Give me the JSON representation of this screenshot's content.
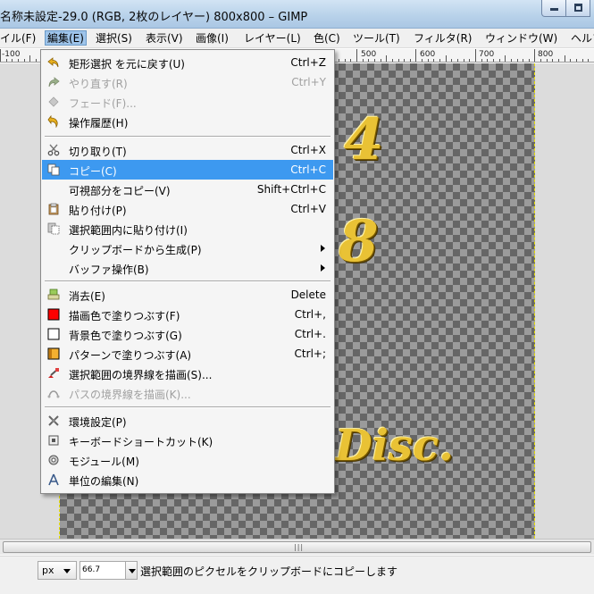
{
  "window": {
    "title": "名称未設定-29.0 (RGB, 2枚のレイヤー) 800x800 – GIMP"
  },
  "menubar": {
    "items": [
      "イル(F)",
      "編集(E)",
      "選択(S)",
      "表示(V)",
      "画像(I)",
      "レイヤー(L)",
      "色(C)",
      "ツール(T)",
      "フィルタ(R)",
      "ウィンドウ(W)",
      "ヘルプ"
    ],
    "active": "編集(E)"
  },
  "ruler": {
    "labels": [
      "-100",
      "500",
      "600",
      "700",
      "800"
    ]
  },
  "edit_menu": {
    "items": [
      {
        "label": "矩形選択 を元に戻す(U)",
        "shortcut": "Ctrl+Z",
        "icon": "undo-icon",
        "enabled": true
      },
      {
        "label": "やり直す(R)",
        "shortcut": "Ctrl+Y",
        "icon": "redo-icon",
        "enabled": false
      },
      {
        "label": "フェード(F)...",
        "shortcut": "",
        "icon": "fade-icon",
        "enabled": false
      },
      {
        "label": "操作履歴(H)",
        "shortcut": "",
        "icon": "history-icon",
        "enabled": true
      },
      {
        "label": "切り取り(T)",
        "shortcut": "Ctrl+X",
        "icon": "scissors-icon",
        "enabled": true
      },
      {
        "label": "コピー(C)",
        "shortcut": "Ctrl+C",
        "icon": "copy-icon",
        "enabled": true,
        "highlighted": true
      },
      {
        "label": "可視部分をコピー(V)",
        "shortcut": "Shift+Ctrl+C",
        "icon": "",
        "enabled": true
      },
      {
        "label": "貼り付け(P)",
        "shortcut": "Ctrl+V",
        "icon": "paste-icon",
        "enabled": true
      },
      {
        "label": "選択範囲内に貼り付け(I)",
        "shortcut": "",
        "icon": "paste-into-icon",
        "enabled": true
      },
      {
        "label": "クリップボードから生成(P)",
        "shortcut": "",
        "icon": "",
        "enabled": true,
        "submenu": true
      },
      {
        "label": "バッファ操作(B)",
        "shortcut": "",
        "icon": "",
        "enabled": true,
        "submenu": true
      },
      {
        "label": "消去(E)",
        "shortcut": "Delete",
        "icon": "eraser-icon",
        "enabled": true
      },
      {
        "label": "描画色で塗りつぶす(F)",
        "shortcut": "Ctrl+,",
        "icon": "fg-fill-icon",
        "enabled": true
      },
      {
        "label": "背景色で塗りつぶす(G)",
        "shortcut": "Ctrl+.",
        "icon": "bg-fill-icon",
        "enabled": true
      },
      {
        "label": "パターンで塗りつぶす(A)",
        "shortcut": "Ctrl+;",
        "icon": "pattern-fill-icon",
        "enabled": true
      },
      {
        "label": "選択範囲の境界線を描画(S)...",
        "shortcut": "",
        "icon": "stroke-selection-icon",
        "enabled": true
      },
      {
        "label": "パスの境界線を描画(K)...",
        "shortcut": "",
        "icon": "stroke-path-icon",
        "enabled": false
      },
      {
        "label": "環境設定(P)",
        "shortcut": "",
        "icon": "preferences-icon",
        "enabled": true
      },
      {
        "label": "キーボードショートカット(K)",
        "shortcut": "",
        "icon": "keyboard-icon",
        "enabled": true
      },
      {
        "label": "モジュール(M)",
        "shortcut": "",
        "icon": "modules-icon",
        "enabled": true
      },
      {
        "label": "単位の編集(N)",
        "shortcut": "",
        "icon": "units-icon",
        "enabled": true
      }
    ]
  },
  "canvas": {
    "texts": [
      "4",
      "8",
      "Disc."
    ]
  },
  "statusbar": {
    "unit": "px",
    "zoom": "66.7",
    "message": "選択範囲のピクセルをクリップボードにコピーします"
  },
  "colors": {
    "highlight": "#3d99f0",
    "gold": "#e9c235",
    "fg_fill": "#ff0000",
    "bg_fill": "#ffffff",
    "pattern_fill": "#f4b030"
  }
}
